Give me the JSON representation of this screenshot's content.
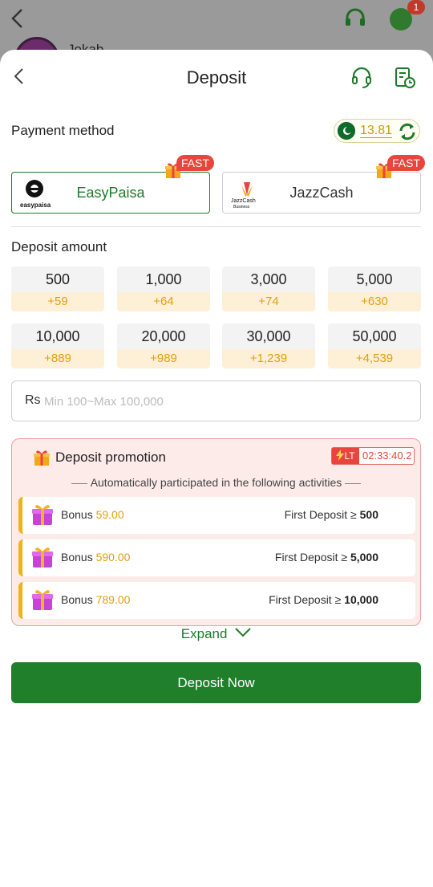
{
  "background": {
    "chat_badge": "1",
    "username": "Jokab"
  },
  "header": {
    "title": "Deposit"
  },
  "payment": {
    "label": "Payment method",
    "balance": "13.81",
    "methods": [
      {
        "name": "EasyPaisa",
        "logo_text": "easypaisa",
        "fast": "FAST"
      },
      {
        "name": "JazzCash",
        "logo_text": "JazzCash",
        "logo_sub": "Business",
        "fast": "FAST"
      }
    ]
  },
  "amount": {
    "label": "Deposit amount",
    "options": [
      {
        "value": "500",
        "bonus": "+59"
      },
      {
        "value": "1,000",
        "bonus": "+64"
      },
      {
        "value": "3,000",
        "bonus": "+74"
      },
      {
        "value": "5,000",
        "bonus": "+630"
      },
      {
        "value": "10,000",
        "bonus": "+889"
      },
      {
        "value": "20,000",
        "bonus": "+989"
      },
      {
        "value": "30,000",
        "bonus": "+1,239"
      },
      {
        "value": "50,000",
        "bonus": "+4,539"
      }
    ],
    "currency": "Rs",
    "placeholder": "Min 100~Max 100,000"
  },
  "promotion": {
    "title": "Deposit promotion",
    "timer_tag": "LT",
    "timer": "02:33:40.2",
    "subtitle": "Automatically participated in the following activities",
    "activities": [
      {
        "bonus_label": "Bonus",
        "bonus": "59.00",
        "rule": "First Deposit ≥",
        "threshold": "500"
      },
      {
        "bonus_label": "Bonus",
        "bonus": "590.00",
        "rule": "First Deposit ≥",
        "threshold": "5,000"
      },
      {
        "bonus_label": "Bonus",
        "bonus": "789.00",
        "rule": "First Deposit ≥",
        "threshold": "10,000"
      }
    ]
  },
  "expand_label": "Expand",
  "deposit_button": "Deposit Now",
  "colors": {
    "brand_green": "#1f7f2a",
    "bonus_gold": "#e0a012",
    "fast_red": "#e8453c",
    "promo_bg": "#fdebe9"
  }
}
